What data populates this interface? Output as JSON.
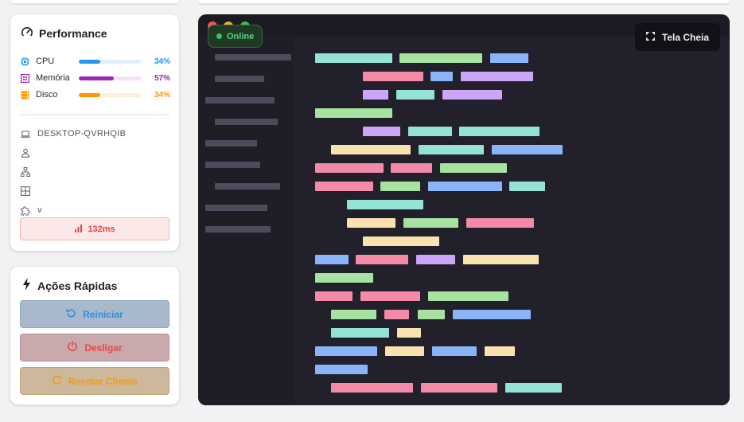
{
  "performance": {
    "title": "Performance",
    "metrics": [
      {
        "label": "CPU",
        "value": "34%",
        "fraction": 0.34,
        "color": "#2196f3",
        "track": "#e1effb",
        "icon": "cpu-icon"
      },
      {
        "label": "Memória",
        "value": "57%",
        "fraction": 0.57,
        "color": "#9c27b0",
        "track": "#f3e1f5",
        "icon": "memory-icon"
      },
      {
        "label": "Disco",
        "value": "34%",
        "fraction": 0.34,
        "color": "#ff9800",
        "track": "#fff0dc",
        "icon": "disk-icon"
      }
    ],
    "info": [
      {
        "icon": "laptop-icon",
        "text": "DESKTOP-QVRHQIB"
      },
      {
        "icon": "user-icon",
        "text": ""
      },
      {
        "icon": "network-icon",
        "text": ""
      },
      {
        "icon": "windows-icon",
        "text": ""
      },
      {
        "icon": "puzzle-icon",
        "text": "v"
      }
    ],
    "ping": "132ms"
  },
  "actions": {
    "title": "Ações Rápidas",
    "buttons": [
      {
        "label": "Reiniciar",
        "icon": "restart-icon"
      },
      {
        "label": "Desligar",
        "icon": "power-icon"
      },
      {
        "label": "Resetar Cliente",
        "icon": "reset-icon"
      }
    ]
  },
  "editor": {
    "status": "Online",
    "fullscreen_label": "Tela Cheia",
    "colors": {
      "teal": "#94e2d5",
      "green": "#a6e3a1",
      "blue": "#89b4fa",
      "pink": "#f38ba8",
      "purple": "#cba6f7",
      "peach": "#f9e2af",
      "gutter": "#4c4c5c"
    }
  },
  "colors": {
    "accent_blue": "#2196f3",
    "accent_red": "#e53935",
    "accent_orange": "#ff9800",
    "online_green": "#39c45e"
  }
}
